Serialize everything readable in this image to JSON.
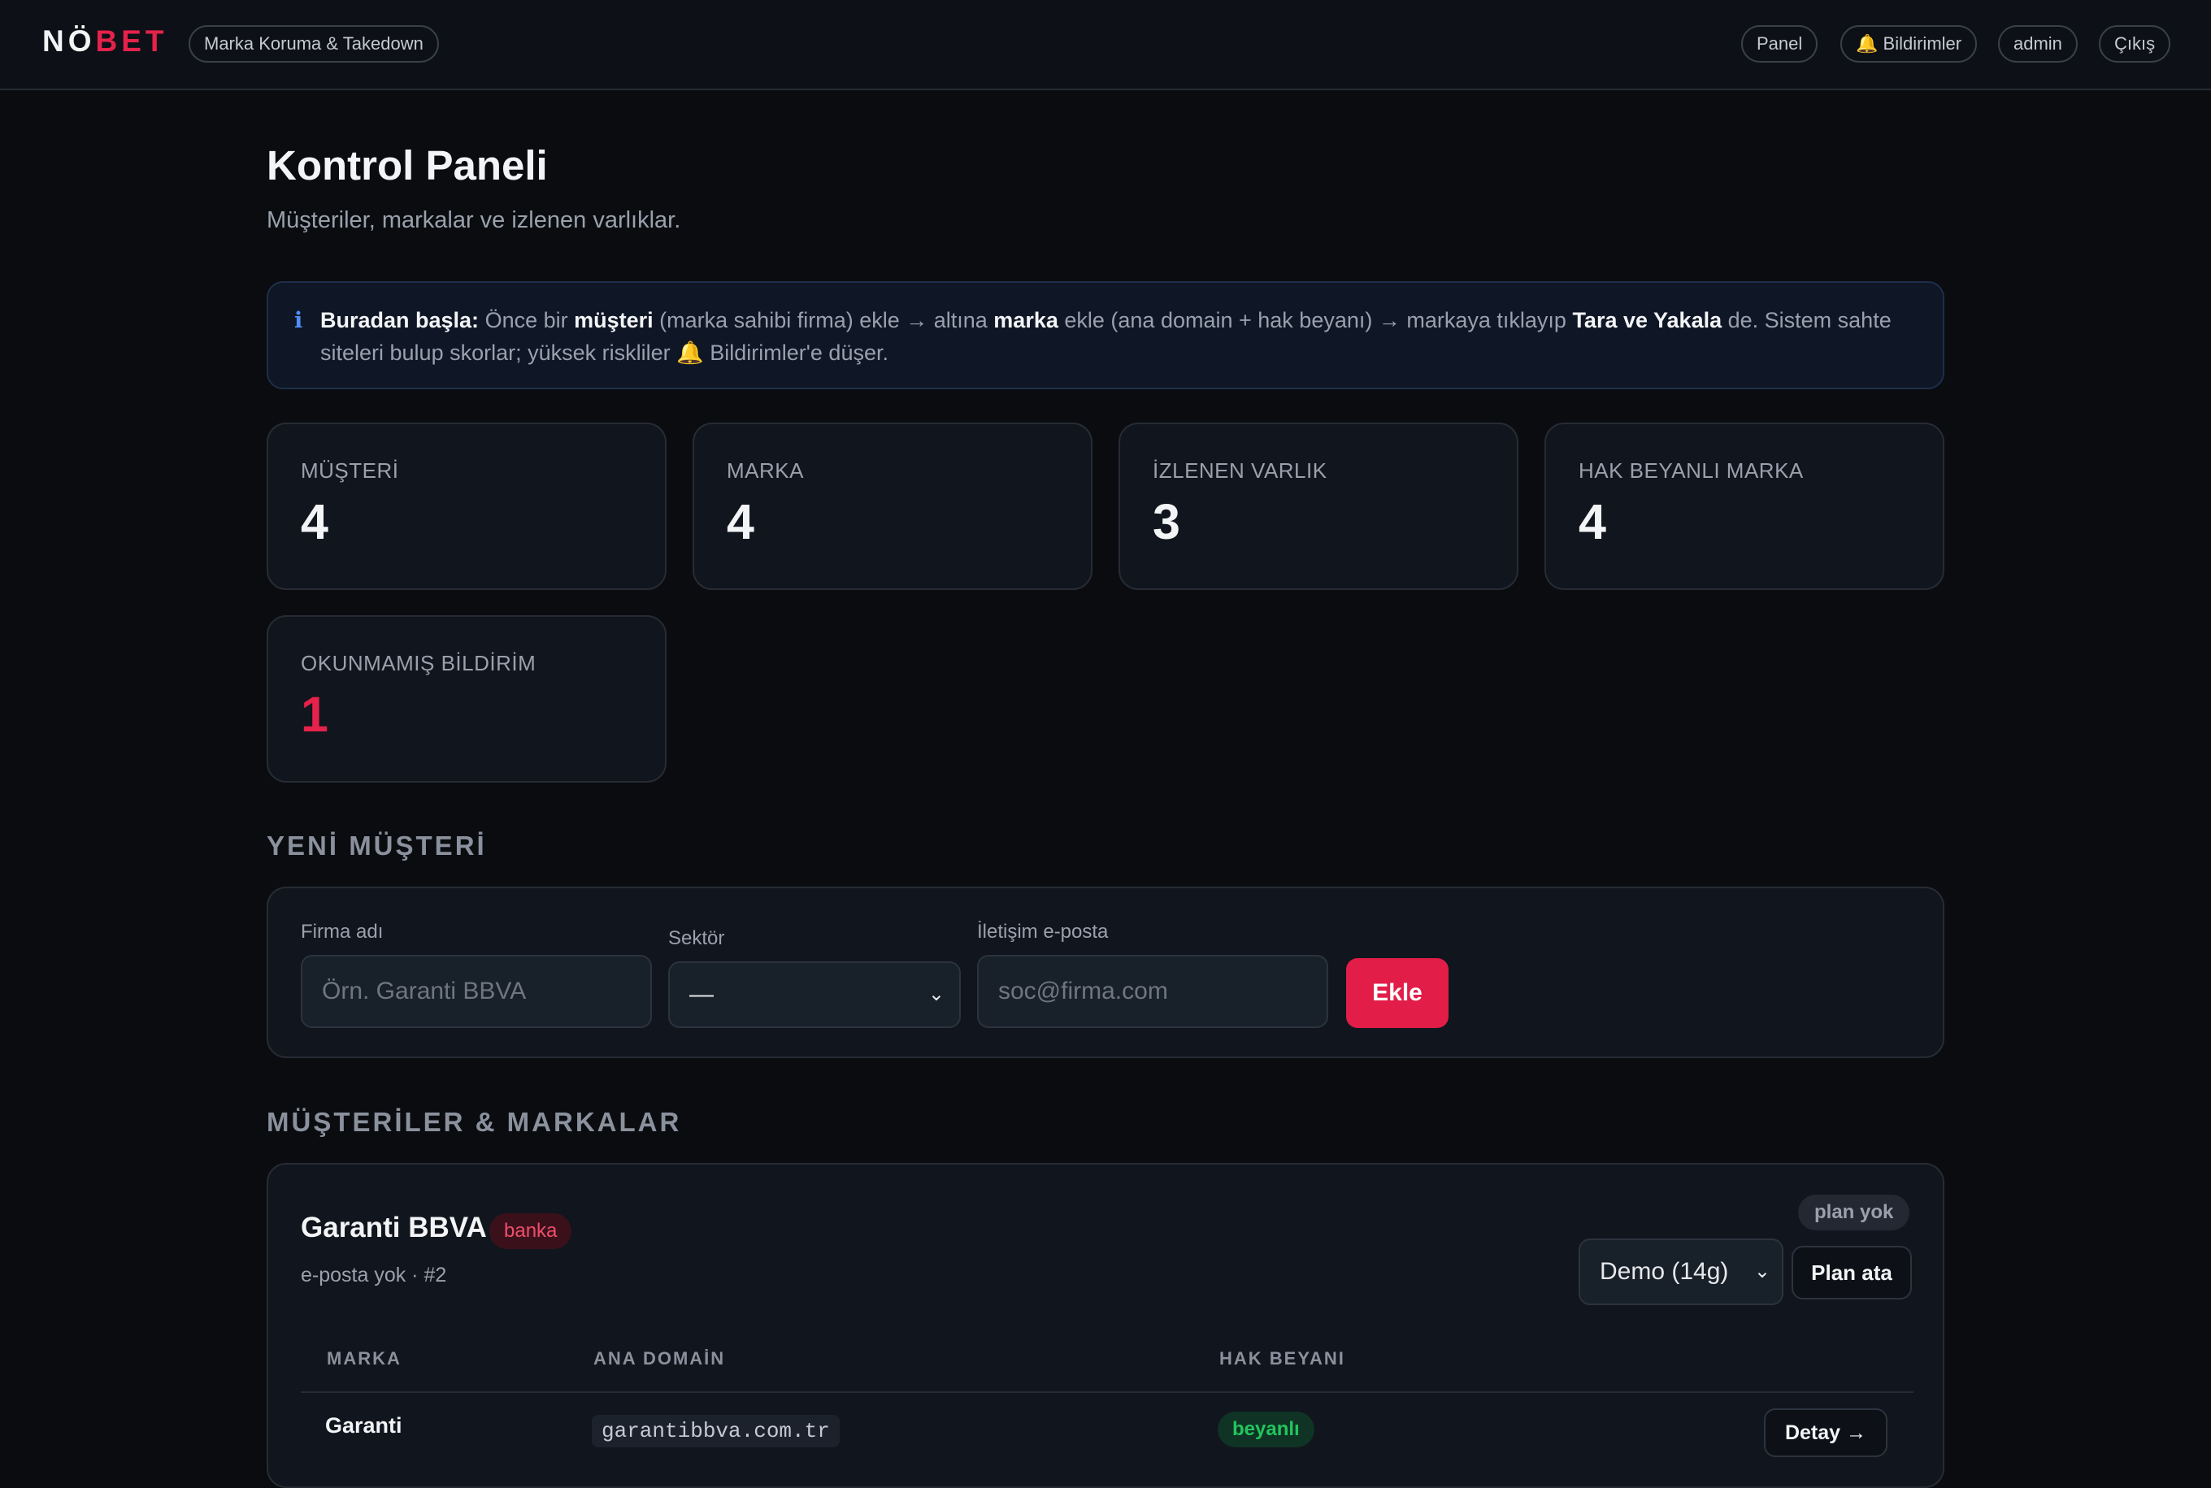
{
  "header": {
    "logo_part1": "NÖ",
    "logo_part2": "BET",
    "brand_tag": "Marka Koruma & Takedown",
    "nav": {
      "panel": "Panel",
      "notifications_icon": "🔔",
      "notifications": "Bildirimler",
      "admin": "admin",
      "logout": "Çıkış"
    }
  },
  "page": {
    "title": "Kontrol Paneli",
    "subtitle": "Müşteriler, markalar ve izlenen varlıklar."
  },
  "info": {
    "icon": "ℹ",
    "lead": "Buradan başla:",
    "t1": " Önce bir ",
    "b1": "müşteri",
    "t2": " (marka sahibi firma) ekle → altına ",
    "b2": "marka",
    "t3": " ekle (ana domain + hak beyanı) → markaya tıklayıp ",
    "b3": "Tara ve Yakala",
    "t4": " de. Sistem sahte siteleri bulup skorlar; yüksek riskliler 🔔 Bildirimler'e düşer."
  },
  "stats": [
    {
      "label": "MÜŞTERİ",
      "value": "4"
    },
    {
      "label": "MARKA",
      "value": "4"
    },
    {
      "label": "İZLENEN VARLIK",
      "value": "3"
    },
    {
      "label": "HAK BEYANLI MARKA",
      "value": "4"
    },
    {
      "label": "OKUNMAMIŞ BİLDİRİM",
      "value": "1"
    }
  ],
  "new_client": {
    "section_title": "YENİ MÜŞTERİ",
    "company_label": "Firma adı",
    "company_placeholder": "Örn. Garanti BBVA",
    "sector_label": "Sektör",
    "sector_value": "—",
    "email_label": "İletişim e-posta",
    "email_placeholder": "soc@firma.com",
    "submit": "Ekle"
  },
  "clients_section": {
    "title": "MÜŞTERİLER & MARKALAR",
    "clients": [
      {
        "name": "Garanti BBVA",
        "sector": "banka",
        "meta": "e-posta yok · #2",
        "plan_status": "plan yok",
        "plan_select": "Demo (14g)",
        "plan_button": "Plan ata",
        "columns": [
          "MARKA",
          "ANA DOMAİN",
          "HAK BEYANI"
        ],
        "brands": [
          {
            "brand": "Garanti",
            "domain": "garantibbva.com.tr",
            "claim": "beyanlı",
            "action": "Detay →"
          }
        ]
      }
    ]
  }
}
